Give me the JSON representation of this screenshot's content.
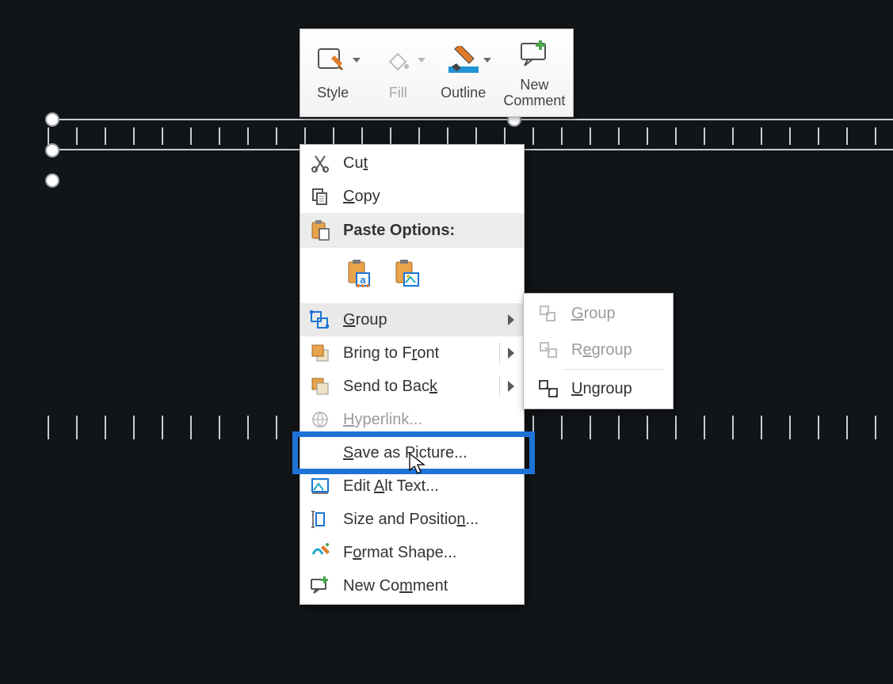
{
  "colors": {
    "accent_blue": "#1e73d6",
    "accent_orange": "#e07b2a",
    "accent_teal": "#1da8c9",
    "background": "#121518"
  },
  "mini_toolbar": {
    "style": "Style",
    "fill": "Fill",
    "outline": "Outline",
    "new_comment_line1": "New",
    "new_comment_line2": "Comment"
  },
  "context_menu": {
    "cut": "Cut",
    "copy": "Copy",
    "paste_options_header": "Paste Options:",
    "group": "Group",
    "bring_to_front": "Bring to Front",
    "send_to_back": "Send to Back",
    "hyperlink": "Hyperlink...",
    "save_as_picture": "Save as Picture...",
    "edit_alt_text": "Edit Alt Text...",
    "size_and_position": "Size and Position...",
    "format_shape": "Format Shape...",
    "new_comment": "New Comment"
  },
  "submenu": {
    "group": "Group",
    "regroup": "Regroup",
    "ungroup": "Ungroup"
  },
  "highlighted_item": "save_as_picture"
}
